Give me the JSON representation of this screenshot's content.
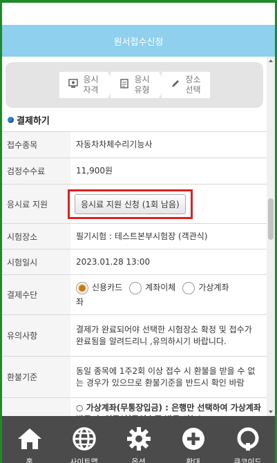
{
  "header": {
    "title": "원서접수신청"
  },
  "steps": [
    {
      "label_line1": "응시",
      "label_line2": "자격",
      "icon": "badge-icon"
    },
    {
      "label_line1": "응시",
      "label_line2": "유형",
      "icon": "document-icon"
    },
    {
      "label_line1": "장소",
      "label_line2": "선택",
      "icon": "pencil-icon"
    }
  ],
  "section": {
    "title": "결제하기"
  },
  "rows": {
    "category": {
      "label": "접수종목",
      "value": "자동차차체수리기능사"
    },
    "fee": {
      "label": "검정수수료",
      "value": "11,900원"
    },
    "support": {
      "label": "응시료 지원",
      "button": "응시료 지원 신청 (1회 남음)"
    },
    "place": {
      "label": "시험장소",
      "value": "필기시험 : 테스트본부시험장 (객관식)"
    },
    "datetime": {
      "label": "시험일시",
      "value": "2023.01.28 13:00"
    },
    "payment": {
      "label": "결제수단",
      "options": [
        "신용카드",
        "계좌이체",
        "가상계좌"
      ],
      "selected": "신용카드",
      "option3_wrap": "좌"
    },
    "notice": {
      "label": "유의사항",
      "value": "결제가 완료되어야 선택한 시험장소 확정 및 접수가 완료됨을 알려드리니 ,유의하시기 바랍니다."
    },
    "refund": {
      "label": "환불기준",
      "value": "동일 종목에 1주2회 이상 접수 시 환불을 받을 수 없는 경우가 있으므로 환불기준을 반드시 확인 바람"
    },
    "extra": {
      "value": "○ 가상계좌(무통장입금) : 은행만 선택하여 가상계좌 발급 후 입금(현금영수증 발급 가능)"
    }
  },
  "nav": [
    {
      "label": "홈",
      "icon": "home-icon"
    },
    {
      "label": "사이트맵",
      "icon": "globe-icon"
    },
    {
      "label": "옵션",
      "icon": "gear-icon"
    },
    {
      "label": "확대",
      "icon": "plus-circle-icon"
    },
    {
      "label": "큐코이드",
      "icon": "q-icon"
    }
  ]
}
